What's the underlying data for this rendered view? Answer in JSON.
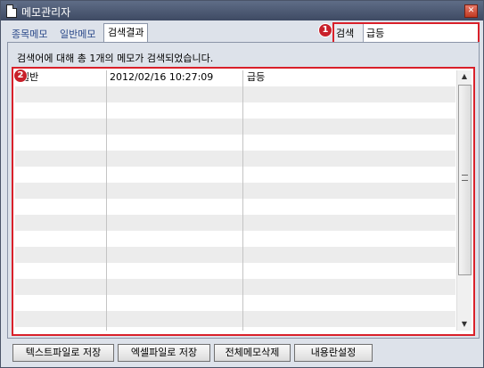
{
  "window": {
    "title": "메모관리자",
    "close_icon": "close-icon"
  },
  "tabs": [
    {
      "label": "종목메모",
      "active": false
    },
    {
      "label": "일반메모",
      "active": false
    },
    {
      "label": "검색결과",
      "active": true
    }
  ],
  "search": {
    "label": "검색",
    "value": "급등",
    "badge": "1"
  },
  "results": {
    "status_text": "검색어에 대해 총 1개의 메모가 검색되었습니다.",
    "badge": "2",
    "rows": [
      {
        "type": "일반",
        "datetime": "2012/02/16 10:27:09",
        "content": "급등"
      }
    ]
  },
  "buttons": [
    {
      "label": "텍스트파일로 저장"
    },
    {
      "label": "엑셀파일로 저장"
    },
    {
      "label": "전체메모삭제"
    },
    {
      "label": "내용란설정"
    }
  ],
  "colors": {
    "title_bar": "#4a5670",
    "highlight": "#d9202a",
    "alt_row": "#ececec"
  }
}
